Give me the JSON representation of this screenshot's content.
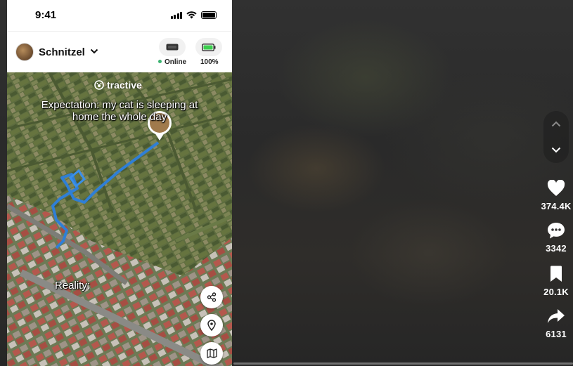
{
  "status_bar": {
    "time": "9:41"
  },
  "app_header": {
    "pet_name": "Schnitzel",
    "tracker_status": "Online",
    "battery": "100%"
  },
  "video_overlay": {
    "brand": "tractive",
    "caption": "Expectation: my cat is sleeping at home the whole day",
    "reality_label": "Reality:"
  },
  "map_buttons": [
    {
      "icon": "share-icon"
    },
    {
      "icon": "location-pin-icon"
    },
    {
      "icon": "map-icon"
    }
  ],
  "actions": {
    "likes": "374.4K",
    "comments": "3342",
    "saves": "20.1K",
    "shares": "6131"
  },
  "colors": {
    "online_dot": "#3cb371",
    "route_line": "#2f7fd6",
    "battery_fill": "#3ccf4e"
  }
}
